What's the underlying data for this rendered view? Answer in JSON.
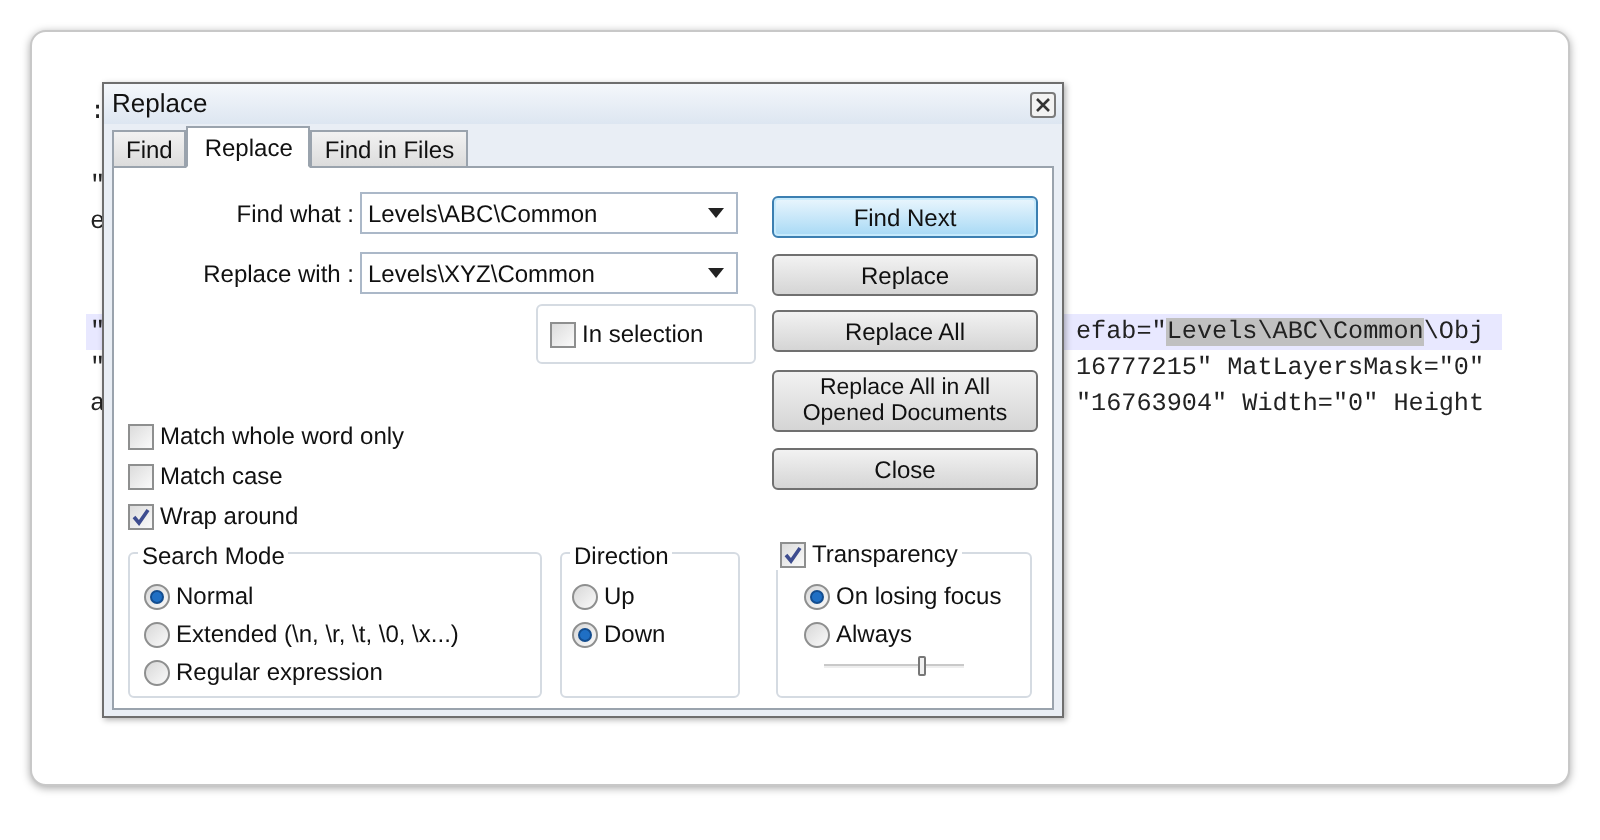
{
  "editor": {
    "lines": [
      {
        "left": ":",
        "current": false
      },
      {
        "left": "\"",
        "current": false
      },
      {
        "left": "e",
        "current": false
      },
      {
        "left": "\"",
        "current": true,
        "right": [
          {
            "text": "efab=\"",
            "match": false
          },
          {
            "text": "Levels\\ABC\\Common",
            "match": true
          },
          {
            "text": "\\Obj",
            "match": false
          }
        ]
      },
      {
        "left": "\"",
        "current": false,
        "right": [
          {
            "text": "16777215\" MatLayersMask=\"0\"",
            "match": false
          }
        ]
      },
      {
        "left": "a",
        "current": false,
        "right": [
          {
            "text": "\"16763904\" Width=\"0\" Height",
            "match": false
          }
        ]
      }
    ]
  },
  "dialog": {
    "title": "Replace",
    "tabs": [
      {
        "label": "Find",
        "selected": false
      },
      {
        "label": "Replace",
        "selected": true
      },
      {
        "label": "Find in Files",
        "selected": false
      }
    ],
    "fields": [
      {
        "label": "Find what :",
        "value": "Levels\\ABC\\Common"
      },
      {
        "label": "Replace with :",
        "value": "Levels\\XYZ\\Common"
      }
    ],
    "in_selection": {
      "label": "In selection",
      "checked": false
    },
    "buttons": [
      {
        "label": "Find Next",
        "default": true
      },
      {
        "label": "Replace",
        "default": false
      },
      {
        "label": "Replace All",
        "default": false
      },
      {
        "label": "Replace All in All Opened Documents",
        "default": false
      },
      {
        "label": "Close",
        "default": false
      }
    ],
    "options": [
      {
        "label": "Match whole word only",
        "checked": false
      },
      {
        "label": "Match case",
        "checked": false
      },
      {
        "label": "Wrap around",
        "checked": true
      }
    ],
    "search_mode": {
      "title": "Search Mode",
      "options": [
        {
          "label": "Normal",
          "selected": true
        },
        {
          "label": "Extended (\\n, \\r, \\t, \\0, \\x...)",
          "selected": false
        },
        {
          "label": "Regular expression",
          "selected": false
        }
      ]
    },
    "direction": {
      "title": "Direction",
      "options": [
        {
          "label": "Up",
          "selected": false
        },
        {
          "label": "Down",
          "selected": true
        }
      ]
    },
    "transparency": {
      "label": "Transparency",
      "checked": true,
      "options": [
        {
          "label": "On losing focus",
          "selected": true
        },
        {
          "label": "Always",
          "selected": false
        }
      ],
      "slider": {
        "level": 0.7
      }
    }
  }
}
